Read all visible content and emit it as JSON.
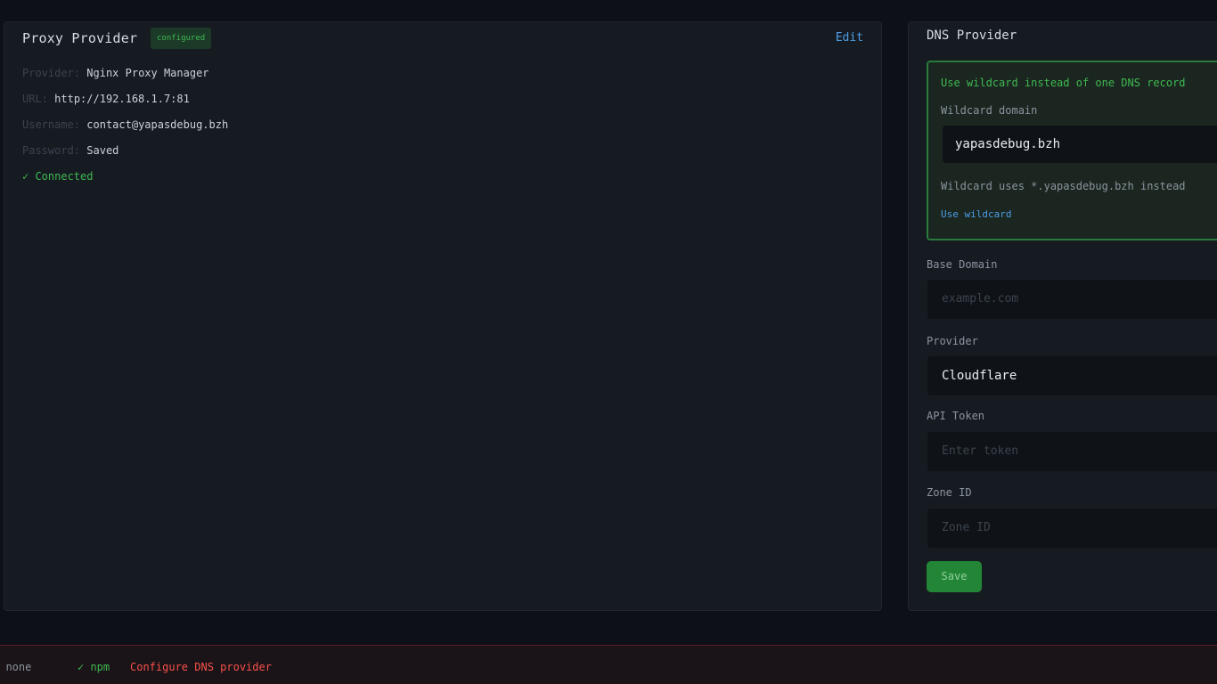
{
  "proxy": {
    "title": "Proxy Provider",
    "badge": "configured",
    "edit": "Edit",
    "rows": [
      {
        "key": "Provider:",
        "value": "Nginx Proxy Manager"
      },
      {
        "key": "URL:",
        "value": "http://192.168.1.7:81"
      },
      {
        "key": "Username:",
        "value": "contact@yapasdebug.bzh"
      },
      {
        "key": "Password:",
        "value": "Saved"
      }
    ],
    "status": "✓ Connected"
  },
  "dns": {
    "title": "DNS Provider",
    "wildcard": {
      "checkbox_label": "Use wildcard instead of one DNS record",
      "domain_label": "Wildcard domain",
      "domain_value": "yapasdebug.bzh",
      "note": "Wildcard uses *.yapasdebug.bzh instead",
      "link": "Use wildcard"
    },
    "base_domain": {
      "label": "Base Domain",
      "placeholder": "example.com"
    },
    "provider": {
      "label": "Provider",
      "value": "Cloudflare"
    },
    "api_token": {
      "label": "API Token",
      "placeholder": "Enter token"
    },
    "zone_id": {
      "label": "Zone ID",
      "placeholder": "Zone ID"
    },
    "save": "Save"
  },
  "status_bar": {
    "item1": "→ none",
    "item2": "✓ npm",
    "item3": "Configure DNS provider"
  },
  "colors": {
    "background": "#0d1117",
    "panel": "#161b22",
    "accent_green": "#3fb950",
    "link_blue": "#4c9ee6",
    "error_red": "#f85149"
  }
}
